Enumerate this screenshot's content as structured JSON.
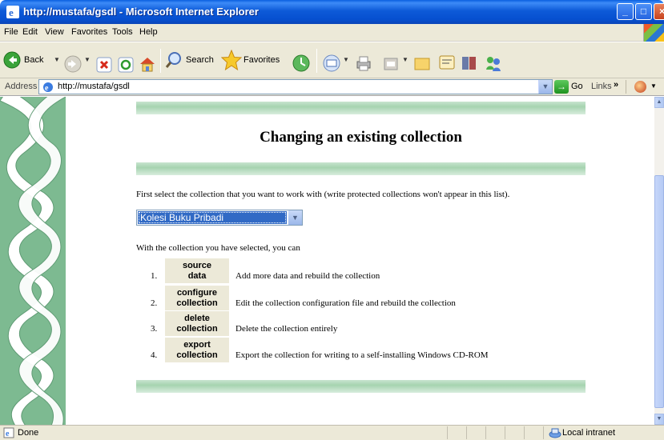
{
  "window": {
    "title": "http://mustafa/gsdl - Microsoft Internet Explorer"
  },
  "menu": {
    "items": [
      "File",
      "Edit",
      "View",
      "Favorites",
      "Tools",
      "Help"
    ]
  },
  "toolbar": {
    "back_label": "Back",
    "search_label": "Search",
    "favorites_label": "Favorites"
  },
  "address": {
    "label": "Address",
    "url": "http://mustafa/gsdl",
    "go_label": "Go",
    "links_label": "Links"
  },
  "page": {
    "heading": "Changing an existing collection",
    "intro": "First select the collection that you want to work with (write protected collections won't appear in this list).",
    "selected_collection": "Kolesi Buku Pribadi",
    "can_text": "With the collection you have selected, you can",
    "actions": [
      {
        "num": "1.",
        "line1": "source",
        "line2": "data",
        "desc": "Add more data and rebuild the collection"
      },
      {
        "num": "2.",
        "line1": "configure",
        "line2": "collection",
        "desc": "Edit the collection configuration file and rebuild the collection"
      },
      {
        "num": "3.",
        "line1": "delete",
        "line2": "collection",
        "desc": "Delete the collection entirely"
      },
      {
        "num": "4.",
        "line1": "export",
        "line2": "collection",
        "desc": "Export the collection for writing to a self-installing Windows CD-ROM"
      }
    ]
  },
  "status": {
    "text": "Done",
    "zone": "Local intranet"
  },
  "colors": {
    "title_bar": "#0a5fe0",
    "band_green": "#a6d3b0",
    "braid_green": "#7dba91",
    "selection_blue": "#316ac5"
  }
}
